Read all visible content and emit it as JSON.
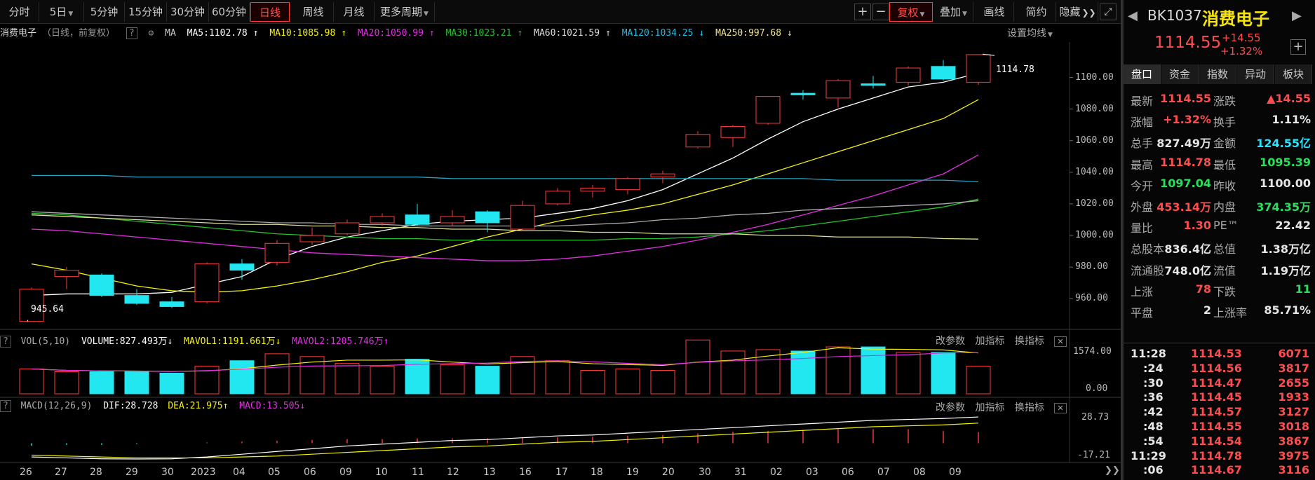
{
  "toolbar": {
    "tabs": [
      "分时",
      "5日",
      "5分钟",
      "15分钟",
      "30分钟",
      "60分钟",
      "日线",
      "周线",
      "月线",
      "更多周期"
    ],
    "active_tab": "日线",
    "right_buttons": [
      "复权",
      "叠加",
      "画线",
      "简约",
      "隐藏"
    ]
  },
  "indicator_line": {
    "name": "消费电子",
    "mode": "（日线，前复权）",
    "ma_label": "MA",
    "ma5": "MA5:1102.78",
    "ma10": "MA10:1085.98",
    "ma20": "MA20:1050.99",
    "ma30": "MA30:1023.21",
    "ma60": "MA60:1021.59",
    "ma120": "MA120:1034.25",
    "ma250": "MA250:997.68",
    "settings": "设置均线"
  },
  "vol_line": {
    "name": "VOL(5,10)",
    "volume": "VOLUME:827.493万",
    "mavol1": "MAVOL1:1191.661万",
    "mavol2": "MAVOL2:1205.746万"
  },
  "macd_line": {
    "name": "MACD(12,26,9)",
    "dif": "DIF:28.728",
    "dea": "DEA:21.975",
    "macd": "MACD:13.505"
  },
  "panel_actions": [
    "改参数",
    "加指标",
    "换指标"
  ],
  "price_axis": [
    "1100.00",
    "1080.00",
    "1060.00",
    "1040.00",
    "1020.00",
    "1000.00",
    "980.00",
    "960.00"
  ],
  "vol_axis": [
    "1574.00",
    "0.00"
  ],
  "macd_axis": [
    "28.73",
    "-17.21"
  ],
  "annotations": {
    "high": "1114.78",
    "low": "945.64"
  },
  "dates": [
    "26",
    "27",
    "28",
    "29",
    "30",
    "2023",
    "04",
    "05",
    "06",
    "09",
    "10",
    "11",
    "12",
    "13",
    "16",
    "17",
    "18",
    "19",
    "20",
    "30",
    "31",
    "02",
    "03",
    "06",
    "07",
    "08",
    "09"
  ],
  "chart_data": {
    "type": "candlestick",
    "candles": [
      {
        "o": 945.6,
        "c": 966,
        "h": 967,
        "l": 945.6
      },
      {
        "o": 974,
        "c": 978,
        "h": 980,
        "l": 966
      },
      {
        "o": 975,
        "c": 962,
        "h": 976,
        "l": 961
      },
      {
        "o": 962,
        "c": 957,
        "h": 966,
        "l": 956
      },
      {
        "o": 958,
        "c": 955,
        "h": 961,
        "l": 954
      },
      {
        "o": 958,
        "c": 982,
        "h": 983,
        "l": 957
      },
      {
        "o": 982,
        "c": 978,
        "h": 985,
        "l": 972
      },
      {
        "o": 983,
        "c": 995,
        "h": 997,
        "l": 981
      },
      {
        "o": 996,
        "c": 1000,
        "h": 1005,
        "l": 994
      },
      {
        "o": 1001,
        "c": 1008,
        "h": 1010,
        "l": 1000
      },
      {
        "o": 1008,
        "c": 1012,
        "h": 1014,
        "l": 1006
      },
      {
        "o": 1013,
        "c": 1007,
        "h": 1020,
        "l": 1006
      },
      {
        "o": 1008,
        "c": 1012,
        "h": 1016,
        "l": 1006
      },
      {
        "o": 1015,
        "c": 1008,
        "h": 1016,
        "l": 1002
      },
      {
        "o": 1004,
        "c": 1019,
        "h": 1022,
        "l": 1003
      },
      {
        "o": 1020,
        "c": 1028,
        "h": 1030,
        "l": 1019
      },
      {
        "o": 1028,
        "c": 1030,
        "h": 1032,
        "l": 1024
      },
      {
        "o": 1029,
        "c": 1036,
        "h": 1037,
        "l": 1026
      },
      {
        "o": 1037,
        "c": 1039,
        "h": 1041,
        "l": 1033
      },
      {
        "o": 1056,
        "c": 1064,
        "h": 1066,
        "l": 1055
      },
      {
        "o": 1062,
        "c": 1069,
        "h": 1070,
        "l": 1056
      },
      {
        "o": 1071,
        "c": 1088,
        "h": 1088,
        "l": 1070
      },
      {
        "o": 1090,
        "c": 1089,
        "h": 1092,
        "l": 1086
      },
      {
        "o": 1087,
        "c": 1098,
        "h": 1099,
        "l": 1081
      },
      {
        "o": 1096,
        "c": 1095,
        "h": 1101,
        "l": 1093
      },
      {
        "o": 1097,
        "c": 1106,
        "h": 1107,
        "l": 1095
      },
      {
        "o": 1107,
        "c": 1099,
        "h": 1111,
        "l": 1098
      },
      {
        "o": 1097,
        "c": 1114.5,
        "h": 1114.78,
        "l": 1095.4
      }
    ],
    "ylim": [
      945,
      1118
    ],
    "ma_series": [
      {
        "name": "MA5",
        "color": "#ffffff",
        "values": [
          962,
          963,
          963,
          963,
          964,
          969,
          974,
          985,
          993,
          999,
          1003,
          1007,
          1009,
          1010,
          1011,
          1014,
          1017,
          1022,
          1029,
          1039,
          1049,
          1061,
          1072,
          1080,
          1087,
          1094,
          1097,
          1102.8
        ]
      },
      {
        "name": "MA10",
        "color": "#f6f30b",
        "values": [
          982,
          978,
          973,
          968,
          965,
          964,
          965,
          968,
          972,
          977,
          983,
          987,
          993,
          999,
          1004,
          1009,
          1013,
          1016,
          1020,
          1026,
          1032,
          1039,
          1046,
          1053,
          1060,
          1067,
          1074,
          1086
        ]
      },
      {
        "name": "MA20",
        "color": "#e22de2",
        "values": [
          1004,
          1003,
          1001,
          999,
          997,
          995,
          993,
          991,
          989,
          988,
          987,
          986,
          985,
          984,
          984,
          985,
          987,
          990,
          993,
          997,
          1002,
          1007,
          1013,
          1019,
          1025,
          1032,
          1039,
          1051
        ]
      },
      {
        "name": "MA30",
        "color": "#22c42a",
        "values": [
          1014,
          1013,
          1011,
          1009,
          1007,
          1005,
          1003,
          1001,
          1000,
          999,
          998,
          998,
          997,
          997,
          997,
          997,
          997,
          998,
          998,
          999,
          1001,
          1003,
          1006,
          1009,
          1012,
          1015,
          1018,
          1023
        ]
      },
      {
        "name": "MA60",
        "color": "#aaaaaa",
        "values": [
          1015,
          1014,
          1013,
          1012,
          1011,
          1010,
          1009,
          1008,
          1008,
          1007,
          1007,
          1006,
          1006,
          1006,
          1006,
          1006,
          1007,
          1008,
          1010,
          1011,
          1013,
          1014,
          1016,
          1017,
          1018,
          1019,
          1020,
          1022
        ]
      },
      {
        "name": "MA120",
        "color": "#22a7c4",
        "values": [
          1038,
          1038,
          1038,
          1037,
          1037,
          1037,
          1037,
          1037,
          1037,
          1037,
          1037,
          1037,
          1036,
          1036,
          1036,
          1036,
          1036,
          1036,
          1036,
          1036,
          1036,
          1036,
          1036,
          1035,
          1035,
          1035,
          1035,
          1034
        ]
      },
      {
        "name": "MA250",
        "color": "#dddd99",
        "values": [
          1013,
          1012,
          1011,
          1010,
          1009,
          1008,
          1007,
          1007,
          1006,
          1006,
          1005,
          1005,
          1004,
          1004,
          1003,
          1003,
          1002,
          1002,
          1001,
          1001,
          1001,
          1000,
          1000,
          999,
          999,
          999,
          998,
          997.7
        ]
      }
    ],
    "volume": [
      900,
      800,
      800,
      800,
      750,
      1000,
      1200,
      1450,
      1350,
      1100,
      1000,
      1250,
      1050,
      1000,
      1350,
      1200,
      850,
      900,
      850,
      1950,
      1550,
      1600,
      1550,
      1700,
      1700,
      1500,
      1500,
      1000
    ],
    "macd_hist": [
      -3,
      -2,
      -2,
      -1,
      0,
      1,
      2,
      3,
      4,
      5,
      5,
      6,
      6,
      6,
      7,
      7,
      8,
      9,
      10,
      12,
      14,
      15,
      16,
      17,
      17,
      17,
      15,
      13.5
    ],
    "dif": [
      -15,
      -16,
      -17,
      -17.2,
      -17,
      -15,
      -12,
      -9,
      -6,
      -3,
      -1,
      1,
      3,
      4,
      6,
      8,
      9,
      11,
      13,
      15,
      17,
      19,
      21,
      23,
      25,
      26,
      27,
      28.7
    ],
    "dea": [
      -13,
      -14,
      -15,
      -16,
      -16,
      -16,
      -15,
      -14,
      -12,
      -10,
      -8,
      -6,
      -4,
      -3,
      -1,
      1,
      2,
      4,
      6,
      8,
      10,
      12,
      14,
      16,
      18,
      19,
      20,
      22
    ]
  },
  "side": {
    "code": "BK1037",
    "name": "消费电子",
    "price": "1114.55",
    "change": "+14.55",
    "change_pct": "+1.32%",
    "tabs": [
      "盘口",
      "资金",
      "指数",
      "异动",
      "板块"
    ],
    "quotes": [
      [
        "最新",
        "1114.55",
        "red",
        "涨跌",
        "▲14.55",
        "red"
      ],
      [
        "涨幅",
        "+1.32%",
        "red",
        "换手",
        "1.11%",
        "white"
      ],
      [
        "总手",
        "827.49万",
        "white",
        "金额",
        "124.55亿",
        "cyan"
      ],
      [
        "最高",
        "1114.78",
        "red",
        "最低",
        "1095.39",
        "green"
      ],
      [
        "今开",
        "1097.04",
        "green",
        "昨收",
        "1100.00",
        "white"
      ],
      [
        "外盘",
        "453.14万",
        "red",
        "内盘",
        "374.35万",
        "green"
      ],
      [
        "量比",
        "1.30",
        "red",
        "PE™",
        "22.42",
        "white"
      ],
      [
        "总股本",
        "836.4亿",
        "white",
        "总值",
        "1.38万亿",
        "white"
      ],
      [
        "流通股",
        "748.0亿",
        "white",
        "流值",
        "1.19万亿",
        "white"
      ],
      [
        "上涨",
        "78",
        "red",
        "下跌",
        "11",
        "green"
      ],
      [
        "平盘",
        "2",
        "white",
        "上涨率",
        "85.71%",
        "white"
      ]
    ],
    "ticks": [
      [
        "11:28",
        "1114.53",
        "6071"
      ],
      [
        ":24",
        "1114.56",
        "3817"
      ],
      [
        ":30",
        "1114.47",
        "2655"
      ],
      [
        ":36",
        "1114.45",
        "1933"
      ],
      [
        ":42",
        "1114.57",
        "3127"
      ],
      [
        ":48",
        "1114.55",
        "3018"
      ],
      [
        ":54",
        "1114.54",
        "3867"
      ],
      [
        "11:29",
        "1114.78",
        "3975"
      ],
      [
        ":06",
        "1114.67",
        "3116"
      ]
    ]
  }
}
